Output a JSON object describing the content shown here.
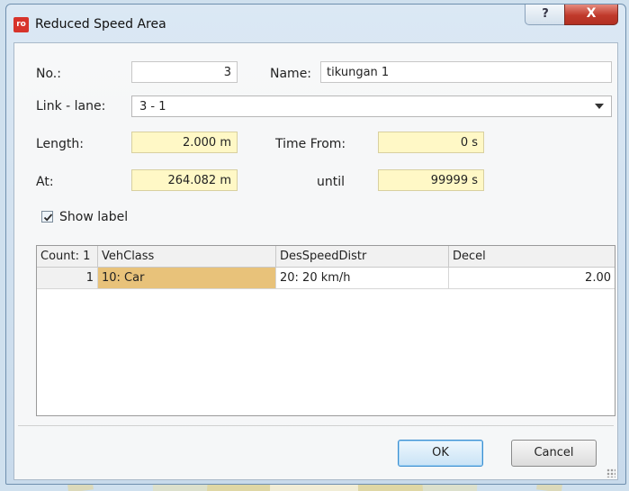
{
  "window": {
    "title": "Reduced Speed Area",
    "icon": "vissim-app-icon",
    "help_label": "?",
    "close_label": "X"
  },
  "form": {
    "no_label": "No.:",
    "no_value": "3",
    "name_label": "Name:",
    "name_value": "tikungan 1",
    "link_label": "Link - lane:",
    "link_value": "3 - 1",
    "length_label": "Length:",
    "length_value": "2.000 m",
    "time_from_label": "Time  From:",
    "time_from_value": "0 s",
    "at_label": "At:",
    "at_value": "264.082 m",
    "until_label": "until",
    "until_value": "99999 s",
    "show_label": "Show label",
    "show_label_checked": true
  },
  "table": {
    "columns": [
      "Count: 1",
      "VehClass",
      "DesSpeedDistr",
      "Decel"
    ],
    "rows": [
      [
        "1",
        "10: Car",
        "20: 20 km/h",
        "2.00"
      ]
    ]
  },
  "buttons": {
    "ok": "OK",
    "cancel": "Cancel"
  },
  "colors": {
    "input_highlight": "#fff8c6",
    "selected_cell": "#e8c27a",
    "close_button": "#c0392b"
  }
}
